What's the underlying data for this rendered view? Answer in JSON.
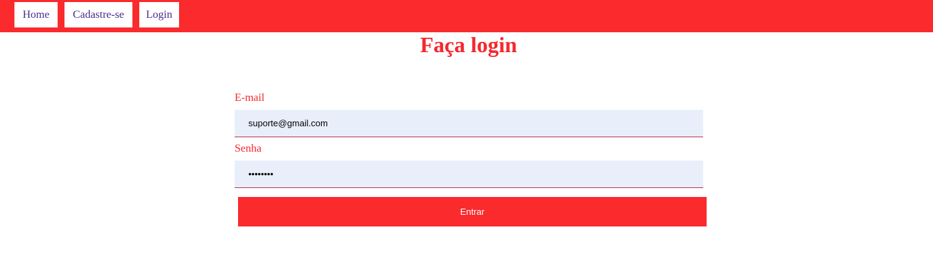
{
  "nav": {
    "items": [
      {
        "label": "Home"
      },
      {
        "label": "Cadastre-se"
      },
      {
        "label": "Login"
      }
    ]
  },
  "page": {
    "title": "Faça login"
  },
  "form": {
    "email": {
      "label": "E-mail",
      "value": "suporte@gmail.com"
    },
    "password": {
      "label": "Senha",
      "value": "••••••••"
    },
    "submit_label": "Entrar"
  },
  "colors": {
    "brand_red": "#fb2a2d",
    "nav_text": "#4b2a8c",
    "input_background": "#e8effb"
  }
}
